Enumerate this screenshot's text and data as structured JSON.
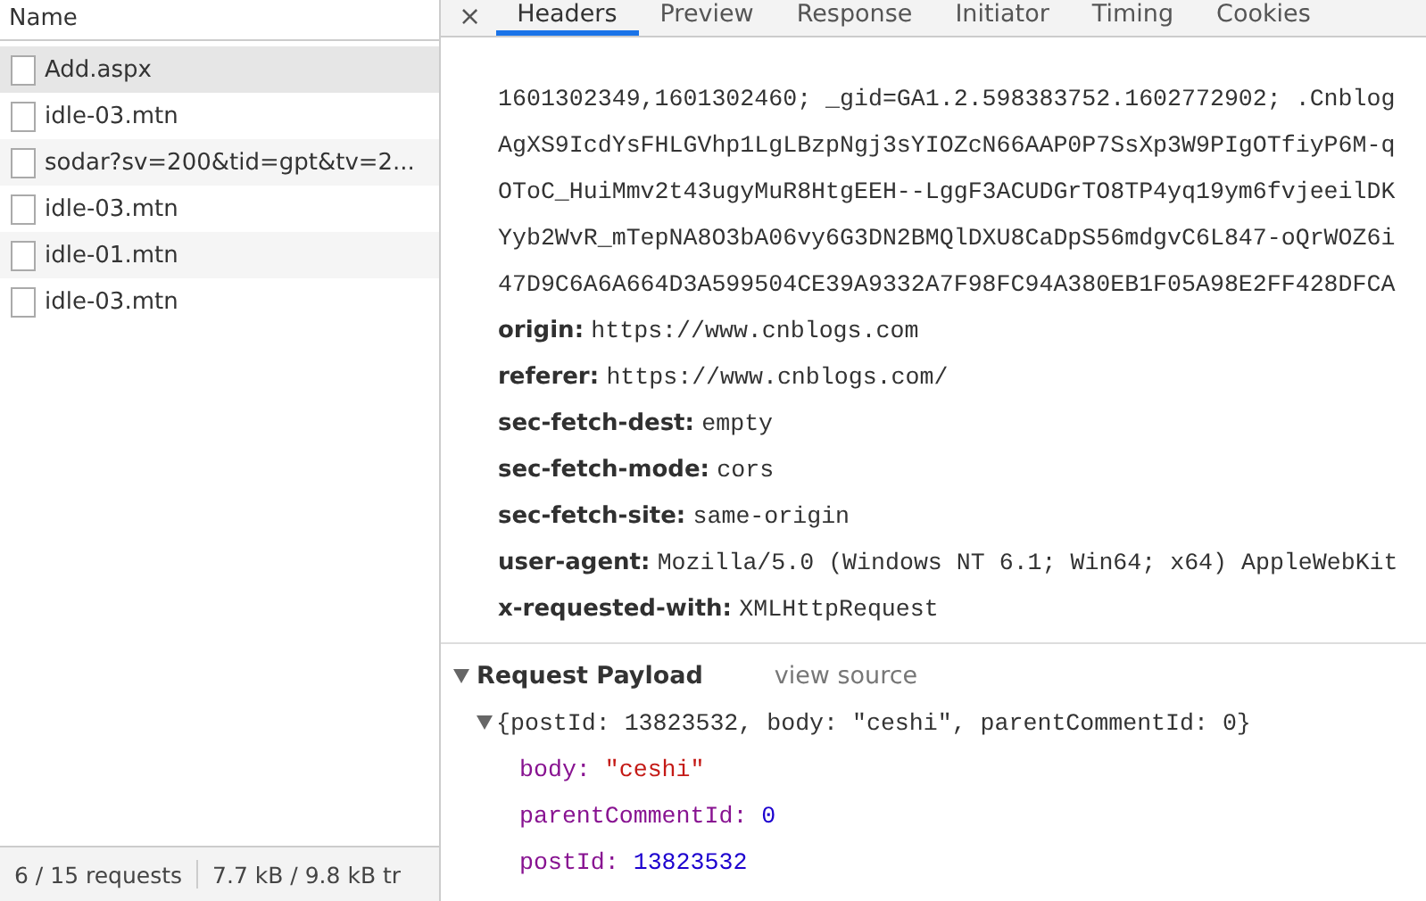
{
  "request_list": {
    "column_header": "Name",
    "rows": [
      {
        "name": "Add.aspx",
        "selected": true
      },
      {
        "name": "idle-03.mtn",
        "selected": false
      },
      {
        "name": "sodar?sv=200&tid=gpt&tv=2...",
        "selected": false
      },
      {
        "name": "idle-03.mtn",
        "selected": false
      },
      {
        "name": "idle-01.mtn",
        "selected": false
      },
      {
        "name": "idle-03.mtn",
        "selected": false
      }
    ]
  },
  "status_bar": {
    "requests": "6 / 15 requests",
    "transferred": "7.7 kB / 9.8 kB tr"
  },
  "detail": {
    "close": "×",
    "tabs": [
      {
        "label": "Headers",
        "selected": true
      },
      {
        "label": "Preview",
        "selected": false
      },
      {
        "label": "Response",
        "selected": false
      },
      {
        "label": "Initiator",
        "selected": false
      },
      {
        "label": "Timing",
        "selected": false
      },
      {
        "label": "Cookies",
        "selected": false
      }
    ],
    "cookie_lines": [
      "1601302349,1601302460; _gid=GA1.2.598383752.1602772902; .Cnblog",
      "AgXS9IcdYsFHLGVhp1LgLBzpNgj3sYIOZcN66AAP0P7SsXp3W9PIgOTfiyP6M-q",
      "OToC_HuiMmv2t43ugyMuR8HtgEEH--LggF3ACUDGrTO8TP4yq19ym6fvjeeilDK",
      "Yyb2WvR_mTepNA8O3bA06vy6G3DN2BMQlDXU8CaDpS56mdgvC6L847-oQrWOZ6i",
      "47D9C6A6A664D3A599504CE39A9332A7F98FC94A380EB1F05A98E2FF428DFCA"
    ],
    "headers": [
      {
        "name": "origin:",
        "value": "https://www.cnblogs.com"
      },
      {
        "name": "referer:",
        "value": "https://www.cnblogs.com/"
      },
      {
        "name": "sec-fetch-dest:",
        "value": "empty"
      },
      {
        "name": "sec-fetch-mode:",
        "value": "cors"
      },
      {
        "name": "sec-fetch-site:",
        "value": "same-origin"
      },
      {
        "name": "user-agent:",
        "value": "Mozilla/5.0 (Windows NT 6.1; Win64; x64) AppleWebKit"
      },
      {
        "name": "x-requested-with:",
        "value": "XMLHttpRequest"
      }
    ],
    "payload": {
      "title": "Request Payload",
      "expanded": true,
      "view_source": "view source",
      "summary": "{postId: 13823532, body: \"ceshi\", parentCommentId: 0}",
      "summary_expanded": true,
      "properties": [
        {
          "key": "body:",
          "value": "\"ceshi\"",
          "kind": "string"
        },
        {
          "key": "parentCommentId:",
          "value": "0",
          "kind": "number"
        },
        {
          "key": "postId:",
          "value": "13823532",
          "kind": "number"
        }
      ]
    }
  }
}
